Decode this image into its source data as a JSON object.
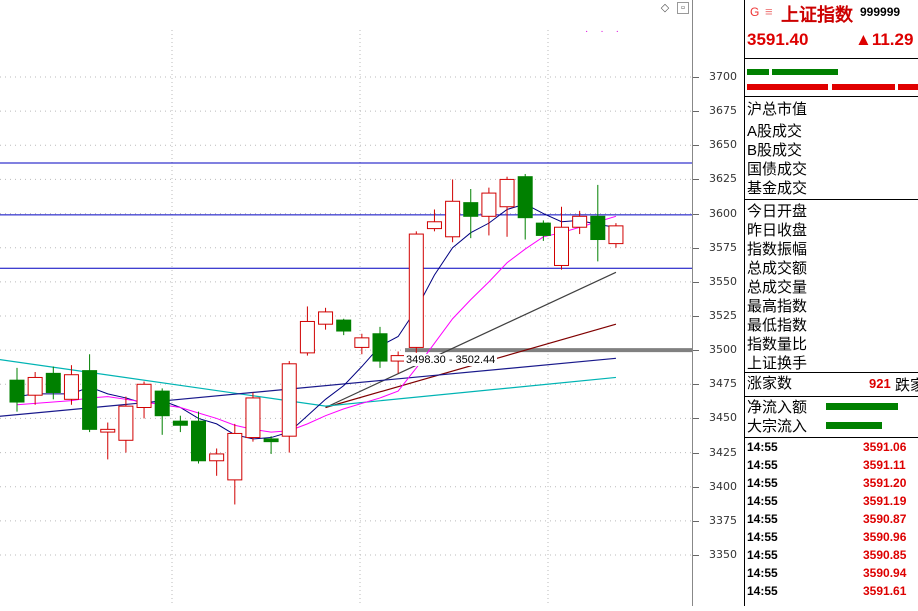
{
  "chart_data": {
    "type": "candlestick",
    "ylim": [
      3330,
      3715
    ],
    "y_ticks": [
      3350,
      3375,
      3400,
      3425,
      3450,
      3475,
      3500,
      3525,
      3550,
      3575,
      3600,
      3625,
      3650,
      3675,
      3700
    ],
    "candles": [
      {
        "o": 3478,
        "c": 3462,
        "h": 3487,
        "l": 3455
      },
      {
        "o": 3467,
        "c": 3480,
        "h": 3484,
        "l": 3460
      },
      {
        "o": 3483,
        "c": 3469,
        "h": 3488,
        "l": 3464
      },
      {
        "o": 3464,
        "c": 3482,
        "h": 3489,
        "l": 3460
      },
      {
        "o": 3485,
        "c": 3442,
        "h": 3497,
        "l": 3440
      },
      {
        "o": 3440,
        "c": 3442,
        "h": 3447,
        "l": 3420
      },
      {
        "o": 3434,
        "c": 3459,
        "h": 3466,
        "l": 3425
      },
      {
        "o": 3458,
        "c": 3475,
        "h": 3477,
        "l": 3450
      },
      {
        "o": 3470,
        "c": 3452,
        "h": 3472,
        "l": 3438
      },
      {
        "o": 3448,
        "c": 3445,
        "h": 3452,
        "l": 3440
      },
      {
        "o": 3448,
        "c": 3419,
        "h": 3455,
        "l": 3417
      },
      {
        "o": 3419,
        "c": 3424,
        "h": 3428,
        "l": 3408
      },
      {
        "o": 3405,
        "c": 3439,
        "h": 3446,
        "l": 3387
      },
      {
        "o": 3436,
        "c": 3465,
        "h": 3469,
        "l": 3433
      },
      {
        "o": 3435,
        "c": 3433,
        "h": 3437,
        "l": 3424
      },
      {
        "o": 3437,
        "c": 3490,
        "h": 3492,
        "l": 3425
      },
      {
        "o": 3498,
        "c": 3521,
        "h": 3532,
        "l": 3496
      },
      {
        "o": 3519,
        "c": 3528,
        "h": 3531,
        "l": 3515
      },
      {
        "o": 3522,
        "c": 3514,
        "h": 3523,
        "l": 3511
      },
      {
        "o": 3502,
        "c": 3509,
        "h": 3512,
        "l": 3497
      },
      {
        "o": 3512,
        "c": 3492,
        "h": 3517,
        "l": 3487
      },
      {
        "o": 3492,
        "c": 3496,
        "h": 3499,
        "l": 3483
      },
      {
        "o": 3502,
        "c": 3585,
        "h": 3587,
        "l": 3498
      },
      {
        "o": 3589,
        "c": 3594,
        "h": 3603,
        "l": 3587
      },
      {
        "o": 3583,
        "c": 3609,
        "h": 3625,
        "l": 3579
      },
      {
        "o": 3608,
        "c": 3598,
        "h": 3618,
        "l": 3582
      },
      {
        "o": 3598,
        "c": 3615,
        "h": 3619,
        "l": 3584
      },
      {
        "o": 3605,
        "c": 3625,
        "h": 3627,
        "l": 3583
      },
      {
        "o": 3627,
        "c": 3597,
        "h": 3629,
        "l": 3581
      },
      {
        "o": 3593,
        "c": 3584,
        "h": 3595,
        "l": 3580
      },
      {
        "o": 3562,
        "c": 3590,
        "h": 3605,
        "l": 3559
      },
      {
        "o": 3590,
        "c": 3598,
        "h": 3602,
        "l": 3585
      },
      {
        "o": 3598,
        "c": 3581,
        "h": 3621,
        "l": 3565
      },
      {
        "o": 3578,
        "c": 3591,
        "h": 3593,
        "l": 3575
      }
    ],
    "ma_lines": [
      {
        "name": "",
        "color": "#000080",
        "values": [
          3466,
          3468,
          3468,
          3468,
          3473,
          3468,
          3465,
          3461,
          3463,
          3458,
          3450,
          3446,
          3438,
          3435,
          3436,
          3440,
          3452,
          3464,
          3474,
          3488,
          3503,
          3510,
          3530,
          3555,
          3575,
          3586,
          3593,
          3603,
          3607,
          3600,
          3594,
          3595,
          3592,
          3590
        ]
      },
      {
        "name": "",
        "color": "#ff00ff",
        "values": [
          3460,
          3461,
          3462,
          3463,
          3465,
          3466,
          3464,
          3462,
          3460,
          3458,
          3454,
          3450,
          3445,
          3442,
          3440,
          3441,
          3446,
          3452,
          3457,
          3461,
          3465,
          3470,
          3487,
          3505,
          3523,
          3537,
          3550,
          3564,
          3574,
          3583,
          3586,
          3590,
          3594,
          3598
        ]
      }
    ],
    "trend_lines": [
      {
        "color": "#404040",
        "from": [
          17,
          3458
        ],
        "to": [
          33,
          3557
        ]
      },
      {
        "color": "#800000",
        "from": [
          17,
          3458
        ],
        "to": [
          33,
          3519
        ]
      },
      {
        "color": "#00b4b4",
        "from": [
          -3,
          3497
        ],
        "to": [
          17,
          3459
        ],
        "to2": [
          33,
          3480
        ]
      },
      {
        "color": "#1a1a8c",
        "from": [
          -3,
          3449
        ],
        "to": [
          33,
          3494
        ]
      }
    ],
    "hlines": [
      {
        "value": 3637,
        "color": "#0000c0"
      },
      {
        "value": 3599,
        "color": "#0000c0"
      },
      {
        "value": 3560,
        "color": "#0000c0"
      },
      {
        "value": 3500,
        "color": "#808080",
        "thick": true
      }
    ],
    "range_label": "3498.30 - 3502.44"
  },
  "panel": {
    "g_icon": "G",
    "menu_icon": "≡",
    "index_name": "上证指数",
    "index_code": "999999",
    "price": "3591.40",
    "change": "▲11.29",
    "labels": [
      "沪总市值",
      "A股成交",
      "B股成交",
      "国债成交",
      "基金成交",
      "今日开盘",
      "昨日收盘",
      "指数振幅",
      "总成交额",
      "总成交量",
      "最高指数",
      "最低指数",
      "指数量比",
      "上证换手"
    ],
    "adv_label": "涨家数",
    "adv_value": "921",
    "dec_label": "跌家",
    "net_inflow_label": "净流入额",
    "block_inflow_label": "大宗流入",
    "ticks": [
      {
        "time": "14:55",
        "price": "3591.06"
      },
      {
        "time": "14:55",
        "price": "3591.11"
      },
      {
        "time": "14:55",
        "price": "3591.20"
      },
      {
        "time": "14:55",
        "price": "3591.19"
      },
      {
        "time": "14:55",
        "price": "3590.87"
      },
      {
        "time": "14:55",
        "price": "3590.96"
      },
      {
        "time": "14:55",
        "price": "3590.85"
      },
      {
        "time": "14:55",
        "price": "3590.94"
      },
      {
        "time": "14:55",
        "price": "3591.61"
      }
    ]
  },
  "colors": {
    "up": "#d00000",
    "down": "#008000"
  }
}
